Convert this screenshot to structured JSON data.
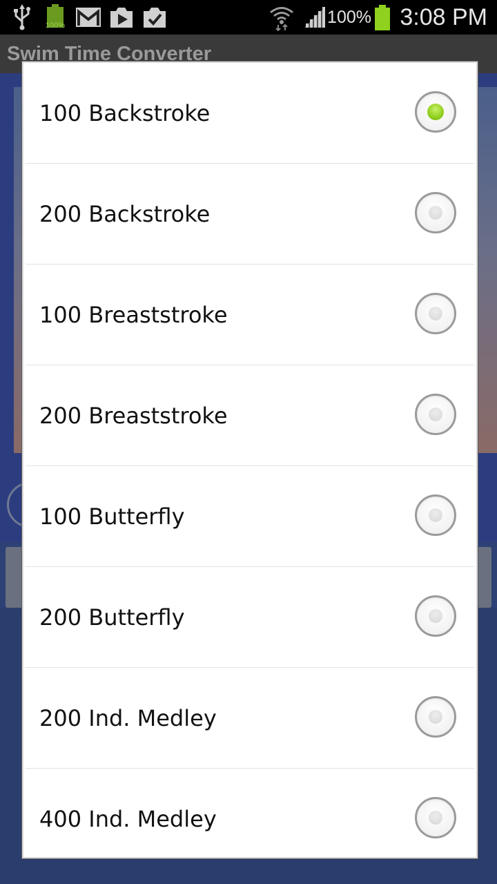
{
  "status_bar": {
    "time": "3:08 PM",
    "battery_percent": "100%",
    "mini_battery_label": "100%",
    "icons": [
      "usb-icon",
      "battery-mini-icon",
      "gmail-icon",
      "play-store-icon",
      "checklist-icon",
      "wifi-icon",
      "signal-icon",
      "battery-icon"
    ],
    "battery_color": "#8fd11e"
  },
  "app": {
    "title": "Swim Time Converter"
  },
  "dialog": {
    "selected_index": 0,
    "accent_color": "#8fcf1c",
    "options": [
      {
        "label": "100 Backstroke",
        "checked": true
      },
      {
        "label": "200 Backstroke",
        "checked": false
      },
      {
        "label": "100 Breaststroke",
        "checked": false
      },
      {
        "label": "200 Breaststroke",
        "checked": false
      },
      {
        "label": "100 Butterfly",
        "checked": false
      },
      {
        "label": "200 Butterfly",
        "checked": false
      },
      {
        "label": "200 Ind. Medley",
        "checked": false
      },
      {
        "label": "400 Ind. Medley",
        "checked": false
      }
    ]
  }
}
